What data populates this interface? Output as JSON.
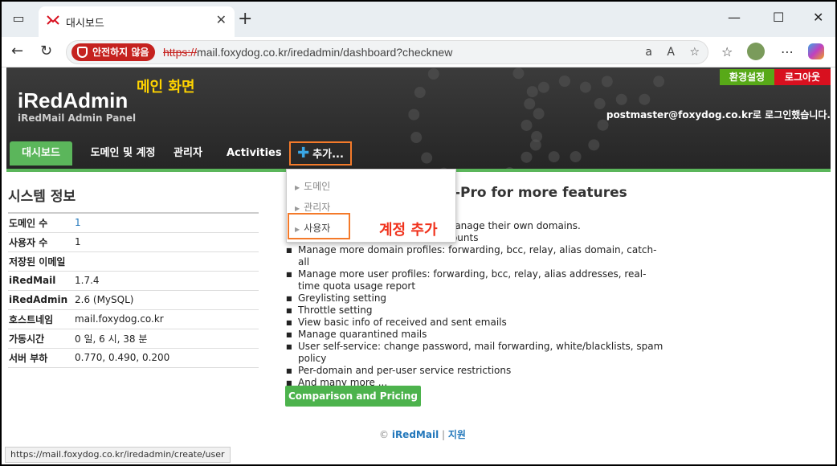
{
  "browser": {
    "tab_title": "대시보드",
    "security_label": "안전하지 않음",
    "url_scheme": "https://",
    "url_rest": "mail.foxydog.co.kr/iredadmin/dashboard?checknew",
    "status_url": "https://mail.foxydog.co.kr/iredadmin/create/user"
  },
  "header": {
    "brand": "iRedAdmin",
    "brand_sub": "iRedMail Admin Panel",
    "annotation": "메인 화면",
    "preferences_label": "환경설정",
    "logout_label": "로그아웃",
    "login_info": "postmaster@foxydog.co.kr로 로그인했습니다."
  },
  "nav": {
    "dashboard": "대시보드",
    "domains_accounts": "도메인 및 계정",
    "admins": "관리자",
    "activities": "Activities",
    "add": "추가..."
  },
  "dropdown": {
    "items": [
      "도메인",
      "관리자",
      "사용자"
    ],
    "annotation": "계정 추가"
  },
  "system_info": {
    "title": "시스템 정보",
    "rows": [
      {
        "key": "도메인 수",
        "value": "1"
      },
      {
        "key": "사용자 수",
        "value": "1"
      },
      {
        "key": "저장된 이메일",
        "value": ""
      },
      {
        "key": "iRedMail",
        "value": "1.7.4"
      },
      {
        "key": "iRedAdmin",
        "value": "2.6 (MySQL)"
      },
      {
        "key": "호스트네임",
        "value": "mail.foxydog.co.kr"
      },
      {
        "key": "가동시간",
        "value": "0 일, 6 시, 38 분"
      },
      {
        "key": "서버 부하",
        "value": "0.770, 0.490, 0.200"
      }
    ]
  },
  "pro": {
    "title": "-Pro for more features",
    "features": [
      "ts to manage their own domains.",
      "as accounts",
      "Manage more domain profiles: forwarding, bcc, relay, alias domain, catch-all",
      "Manage more user profiles: forwarding, bcc, relay, alias addresses, real-time quota usage report",
      "Greylisting setting",
      "Throttle setting",
      "View basic info of received and sent emails",
      "Manage quarantined mails",
      "User self-service: change password, mail forwarding, white/blacklists, spam policy",
      "Per-domain and per-user service restrictions",
      "And many more ..."
    ],
    "pricing_button": "Comparison and Pricing"
  },
  "footer": {
    "copyright": "©",
    "iredmail": "iRedMail",
    "separator": "|",
    "support": "지원"
  }
}
